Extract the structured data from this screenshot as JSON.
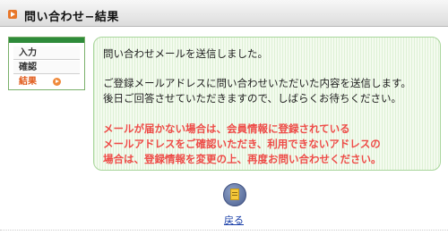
{
  "header": {
    "title": "問い合わせ−結果"
  },
  "steps": {
    "items": [
      {
        "label": "入力"
      },
      {
        "label": "確認"
      },
      {
        "label": "結果"
      }
    ],
    "current_index": 2
  },
  "message": {
    "lines": [
      "問い合わせメールを送信しました。",
      "ご登録メールアドレスに問い合わせいただいた内容を送信します。",
      "後日ご回答させていただきますので、しばらくお待ちください。"
    ],
    "warning_lines": [
      "メールが届かない場合は、会員情報に登録されている",
      "メールアドレスをご確認いただき、利用できないアドレスの",
      "場合は、登録情報を変更の上、再度お問い合わせください。"
    ]
  },
  "back": {
    "label": "戻る",
    "icon": "document-icon"
  },
  "colors": {
    "accent_orange": "#e8772a",
    "warning_red": "#ee4b47",
    "panel_border": "#a9d69c",
    "link_blue": "#1a3fa8"
  }
}
